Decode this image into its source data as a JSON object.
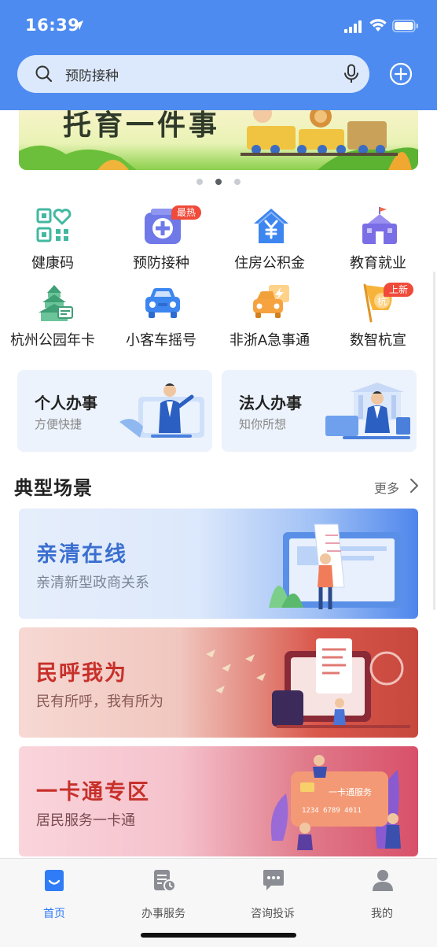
{
  "status": {
    "time": "16:39"
  },
  "search": {
    "text": "预防接种"
  },
  "banner": {
    "title": "托育一件事",
    "page_count": 3,
    "active_page": 2
  },
  "grid": [
    {
      "label": "健康码",
      "icon": "qr-code-heart-icon"
    },
    {
      "label": "预防接种",
      "icon": "medical-cross-icon",
      "tag": "最热"
    },
    {
      "label": "住房公积金",
      "icon": "house-yen-icon"
    },
    {
      "label": "教育就业",
      "icon": "school-icon"
    },
    {
      "label": "杭州公园年卡",
      "icon": "park-pagoda-icon"
    },
    {
      "label": "小客车摇号",
      "icon": "car-icon"
    },
    {
      "label": "非浙A急事通",
      "icon": "car-lightning-icon"
    },
    {
      "label": "数智杭宣",
      "icon": "flag-icon",
      "tag": "上新",
      "flag_text": "杭"
    }
  ],
  "services": [
    {
      "title": "个人办事",
      "subtitle": "方便快捷"
    },
    {
      "title": "法人办事",
      "subtitle": "知你所想"
    }
  ],
  "section": {
    "title": "典型场景",
    "more": "更多"
  },
  "scenes": [
    {
      "title": "亲清在线",
      "subtitle": "亲清新型政商关系"
    },
    {
      "title": "民呼我为",
      "subtitle": "民有所呼，我有所为"
    },
    {
      "title": "一卡通专区",
      "subtitle": "居民服务一卡通",
      "card_title": "一卡通服务",
      "card_number": "1234 6789 4011"
    }
  ],
  "tabs": [
    {
      "label": "首页",
      "active": true
    },
    {
      "label": "办事服务"
    },
    {
      "label": "咨询投诉"
    },
    {
      "label": "我的"
    }
  ],
  "colors": {
    "primary": "#4d8bf0",
    "tag_red": "#f04a3a",
    "active_tab": "#2f7cf6"
  }
}
